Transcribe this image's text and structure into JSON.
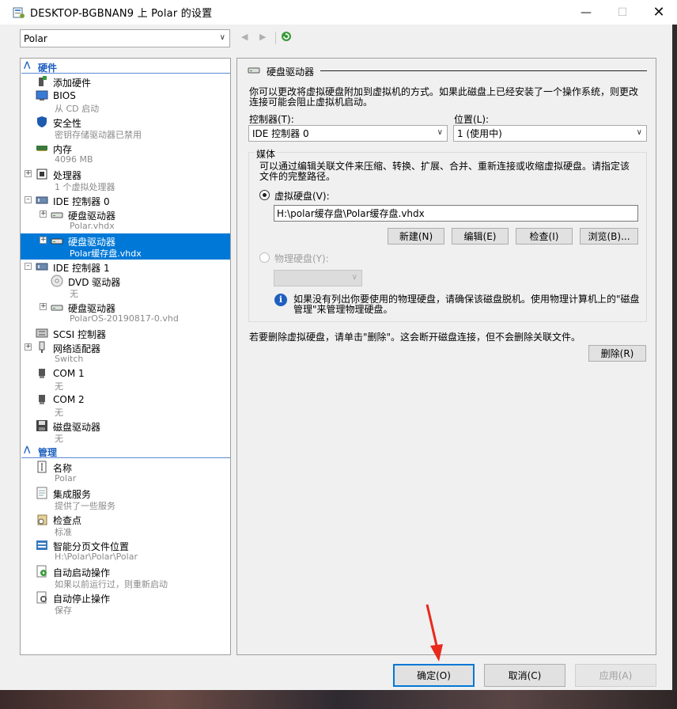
{
  "window": {
    "title": "DESKTOP-BGBNAN9 上 Polar 的设置",
    "minimize_icon": "minimize-icon",
    "maximize_icon": "maximize-icon",
    "close_icon": "close-icon"
  },
  "toolbar": {
    "vm_name": "Polar"
  },
  "tree": {
    "hardware_section": "硬件",
    "management_section": "管理",
    "hardware_items": [
      {
        "name": "添加硬件",
        "sub": ""
      },
      {
        "name": "BIOS",
        "sub": "从 CD 启动"
      },
      {
        "name": "安全性",
        "sub": "密钥存储驱动器已禁用"
      },
      {
        "name": "内存",
        "sub": "4096 MB"
      },
      {
        "name": "处理器",
        "sub": "1 个虚拟处理器"
      },
      {
        "name": "IDE 控制器 0",
        "sub": ""
      },
      {
        "name": "硬盘驱动器",
        "sub": "Polar.vhdx"
      },
      {
        "name": "硬盘驱动器",
        "sub": "Polar缓存盘.vhdx"
      },
      {
        "name": "IDE 控制器 1",
        "sub": ""
      },
      {
        "name": "DVD 驱动器",
        "sub": "无"
      },
      {
        "name": "硬盘驱动器",
        "sub": "PolarOS-20190817-0.vhd"
      },
      {
        "name": "SCSI 控制器",
        "sub": ""
      },
      {
        "name": "网络适配器",
        "sub": "Switch"
      },
      {
        "name": "COM 1",
        "sub": "无"
      },
      {
        "name": "COM 2",
        "sub": "无"
      },
      {
        "name": "磁盘驱动器",
        "sub": "无"
      }
    ],
    "management_items": [
      {
        "name": "名称",
        "sub": "Polar"
      },
      {
        "name": "集成服务",
        "sub": "提供了一些服务"
      },
      {
        "name": "检查点",
        "sub": "标准"
      },
      {
        "name": "智能分页文件位置",
        "sub": "H:\\Polar\\Polar\\Polar"
      },
      {
        "name": "自动启动操作",
        "sub": "如果以前运行过，则重新启动"
      },
      {
        "name": "自动停止操作",
        "sub": "保存"
      }
    ]
  },
  "panel": {
    "heading": "硬盘驱动器",
    "description": "你可以更改将虚拟硬盘附加到虚拟机的方式。如果此磁盘上已经安装了一个操作系统，则更改连接可能会阻止虚拟机启动。",
    "controller_label": "控制器(T):",
    "controller_value": "IDE 控制器 0",
    "location_label": "位置(L):",
    "location_value": "1 (使用中)",
    "media_label": "媒体",
    "media_desc": "可以通过编辑关联文件来压缩、转换、扩展、合并、重新连接或收缩虚拟硬盘。请指定该文件的完整路径。",
    "vhd_radio": "虚拟硬盘(V):",
    "vhd_path": "H:\\polar缓存盘\\Polar缓存盘.vhdx",
    "btn_new": "新建(N)",
    "btn_edit": "编辑(E)",
    "btn_inspect": "检查(I)",
    "btn_browse": "浏览(B)...",
    "phys_radio": "物理硬盘(Y):",
    "phys_value": "",
    "info_text": "如果没有列出你要使用的物理硬盘，请确保该磁盘脱机。使用物理计算机上的\"磁盘管理\"来管理物理硬盘。",
    "remove_text": "若要删除虚拟硬盘，请单击\"删除\"。这会断开磁盘连接，但不会删除关联文件。",
    "btn_remove": "删除(R)"
  },
  "footer": {
    "ok": "确定(O)",
    "cancel": "取消(C)",
    "apply": "应用(A)"
  },
  "colors": {
    "accent": "#0078d7",
    "section_header": "#1d5fbf",
    "annotation_arrow": "#e8291c"
  }
}
